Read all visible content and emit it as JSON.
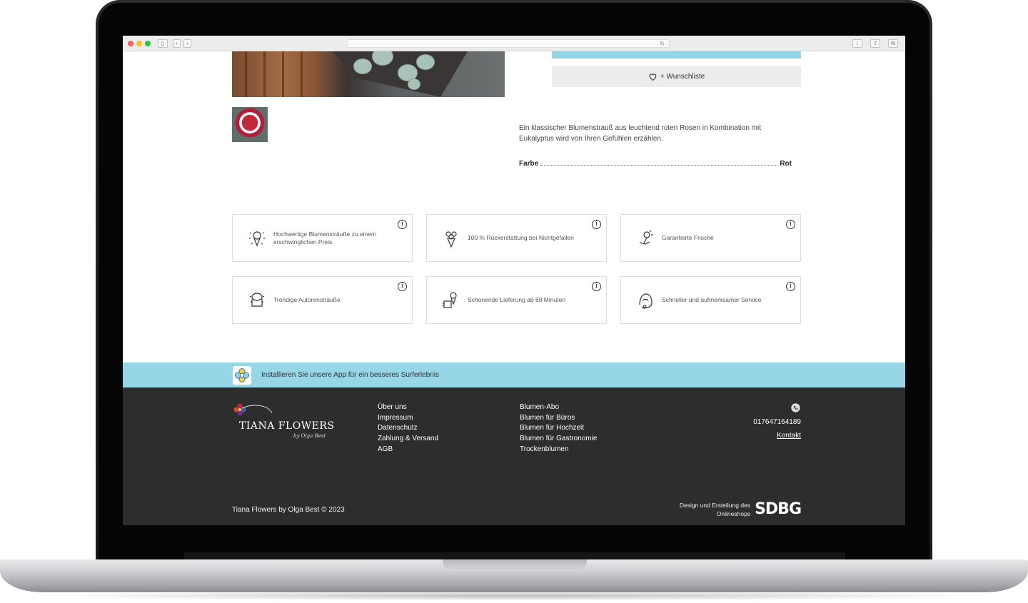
{
  "product": {
    "wishlist_label": "+ Wunschliste",
    "description": "Ein klassischer Blumenstrauß aus leuchtend roten Rosen in Kombination mit Eukalyptus wird von Ihren Gefühlen erzählen.",
    "attribute_label": "Farbe",
    "attribute_value": "Rot"
  },
  "features": [
    {
      "text": "Hochwertige Blumensträuße zu einem erschwinglichen Preis",
      "icon": "bouquet-sparkle-icon"
    },
    {
      "text": "100 % Rückerstattung bei Nichtgefallen",
      "icon": "bouquet-icon"
    },
    {
      "text": "Garantierte Frische",
      "icon": "flower-hand-icon"
    },
    {
      "text": "Trendige Autorensträuße",
      "icon": "hatbox-bouquet-icon"
    },
    {
      "text": "Schonende Lieferung ab 60 Minuten",
      "icon": "delivery-bouquet-icon"
    },
    {
      "text": "Schneller und aufmerksamer Service",
      "icon": "support-agent-icon"
    }
  ],
  "info_glyph": "i",
  "app_banner": {
    "text": "Installieren Sie unsere App für ein besseres Surferlebnis"
  },
  "footer": {
    "logo_title": "TIANA FLOWERS",
    "logo_subtitle": "by Olga Best",
    "col1": [
      "Über uns",
      "Impressum",
      "Datenschutz",
      "Zahlung & Versand",
      "AGB"
    ],
    "col2": [
      "Blumen-Abo",
      "Blumen für Büros",
      "Blumen für Hochzeit",
      "Blumen für Gastronomie",
      "Trockenblumen"
    ],
    "phone": "017647164189",
    "contact_label": "Kontakt",
    "copyright": "Tiana Flowers by Olga Best © 2023",
    "credit_line1": "Design und Erstellung des",
    "credit_line2": "Onlineshops",
    "credit_brand": "SDBG"
  },
  "colors": {
    "accent": "#97d6e6",
    "footer_bg": "#2d2d2d"
  }
}
